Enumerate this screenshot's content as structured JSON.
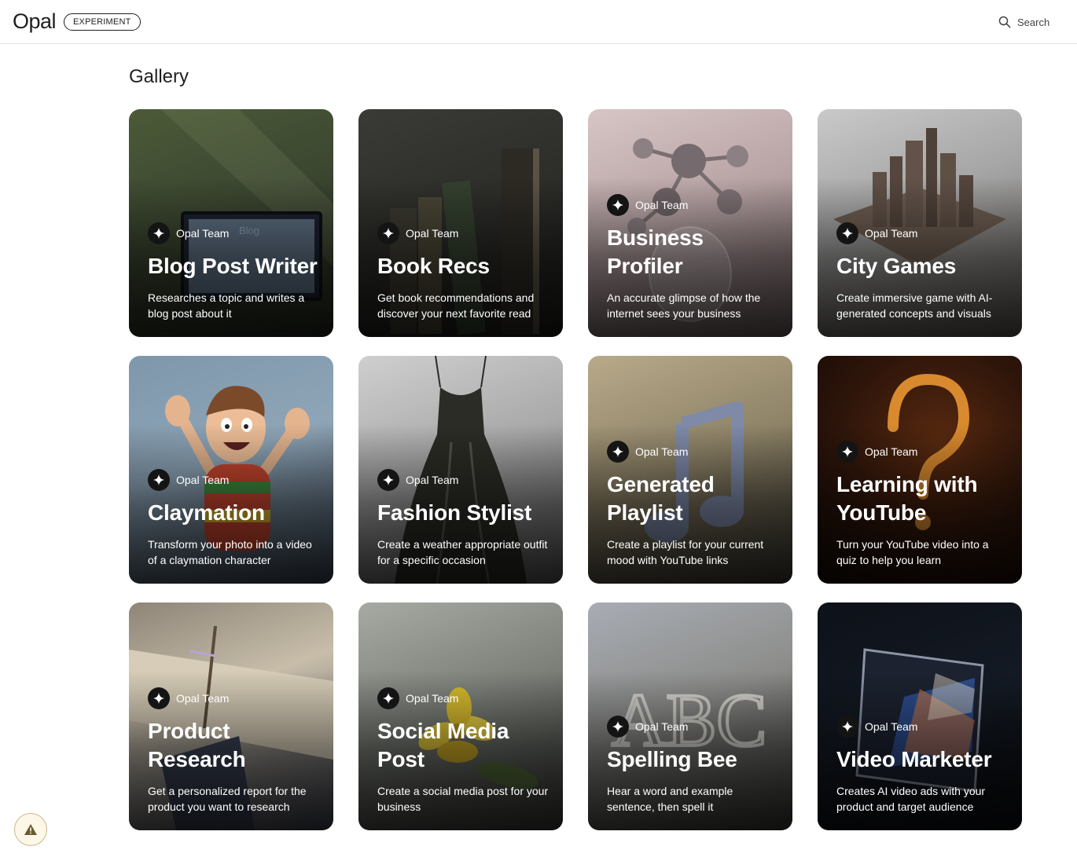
{
  "header": {
    "logo": "Opal",
    "badge": "EXPERIMENT",
    "search_label": "Search",
    "search_icon": "search-icon"
  },
  "page": {
    "title": "Gallery"
  },
  "cards": [
    {
      "author": "Opal Team",
      "title": "Blog Post Writer",
      "description": "Researches a topic and writes a blog post about it",
      "image_text": "Blog"
    },
    {
      "author": "Opal Team",
      "title": "Book Recs",
      "description": "Get book recommendations and discover your next favorite read"
    },
    {
      "author": "Opal Team",
      "title": "Business Profiler",
      "description": "An accurate glimpse of how the internet sees your business"
    },
    {
      "author": "Opal Team",
      "title": "City Games",
      "description": "Create immersive game with AI-generated concepts and visuals"
    },
    {
      "author": "Opal Team",
      "title": "Claymation",
      "description": "Transform your photo into a video of a claymation character"
    },
    {
      "author": "Opal Team",
      "title": "Fashion Stylist",
      "description": "Create a weather appropriate outfit for a specific occasion"
    },
    {
      "author": "Opal Team",
      "title": "Generated Playlist",
      "description": "Create a playlist for your current mood with YouTube links"
    },
    {
      "author": "Opal Team",
      "title": "Learning with YouTube",
      "description": "Turn your YouTube video into a quiz to help you learn"
    },
    {
      "author": "Opal Team",
      "title": "Product Research",
      "description": "Get a personalized report for the product you want to research"
    },
    {
      "author": "Opal Team",
      "title": "Social Media Post",
      "description": "Create a social media post for your business"
    },
    {
      "author": "Opal Team",
      "title": "Spelling Bee",
      "description": "Hear a word and example sentence, then spell it",
      "image_text": "ABC"
    },
    {
      "author": "Opal Team",
      "title": "Video Marketer",
      "description": "Creates AI video ads with your product and target audience"
    }
  ],
  "footer": {
    "alert_icon": "warning-icon"
  }
}
